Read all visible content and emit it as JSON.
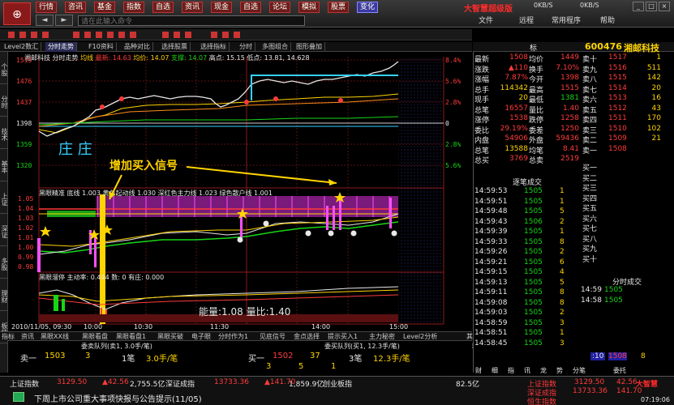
{
  "toolbar": {
    "buttons": [
      "行情",
      "咨讯",
      "基金",
      "指数",
      "自选",
      "资讯",
      "现金",
      "自选",
      "论坛",
      "模拟",
      "股票",
      "变化"
    ],
    "command_placeholder": "请在此输入命令",
    "back": "◄",
    "forward": "►"
  },
  "brand": "大智慧超级版",
  "speed": [
    "0KB/S",
    "0KB/S"
  ],
  "menus": [
    "文件",
    "远程",
    "常用程序",
    "帮助"
  ],
  "tabs": [
    "Level2数汇",
    "分时走势",
    "F10资料",
    "品种对比",
    "选择股票",
    "选择指标",
    "分时",
    "多图组合",
    "图形叠加"
  ],
  "vertical_tabs": [
    "个股",
    "分时",
    "技术",
    "基本",
    "上证",
    "深证",
    "多股",
    "理财",
    "板块"
  ],
  "chart": {
    "header_name": "湘邮科技 分时走势",
    "header_label": "均线",
    "header_values": [
      "最新: 14.63",
      "均价: 14.07",
      "支撑: 14.07",
      "高点: 15.15",
      "低点: 13.81, 14.628"
    ],
    "y_prices": [
      "1515",
      "1476",
      "1437",
      "1398",
      "1359",
      "1320"
    ],
    "y_pcts": [
      "8.4%",
      "5.6%",
      "2.8%",
      "0",
      "2.8%",
      "5.6%"
    ],
    "mid_prices": [
      "1.05",
      "1.04",
      "1.03",
      "1.02",
      "1.01",
      "1.00",
      "0.99",
      "0.98"
    ],
    "mid_header": "黑眼精准  底线 1.003   黄色起动线 1.030  深红色主力线 1.023  绿色散户线 1.001",
    "low_header": "黑眼溜停   主动率: 0.444  数: 0  有庄: 0.000",
    "annotation": "增加买入信号",
    "volume_ratio": "能量:1.08   量比:1.40",
    "zhuang": "庄 庄",
    "times": [
      "2010/11/05, 09:30",
      "10:00",
      "10:30",
      "11:30",
      "14:00",
      "15:00"
    ]
  },
  "quote": {
    "code": "600476",
    "name": "湘邮科技",
    "title_tab": "标",
    "rows": [
      {
        "l": "最新",
        "v": "1508",
        "l2": "均价",
        "v2": "1449"
      },
      {
        "l": "涨跌",
        "v": "▲110",
        "l2": "换手",
        "v2": "7.10%"
      },
      {
        "l": "涨幅",
        "v": "7.87%",
        "l2": "今开",
        "v2": "1398"
      },
      {
        "l": "总手",
        "v": "114342",
        "l2": "最高",
        "v2": "1515"
      },
      {
        "l": "现手",
        "v": "20",
        "l2": "最低",
        "v2": "1381"
      },
      {
        "l": "总笔",
        "v": "16557",
        "l2": "量比",
        "v2": "1.40"
      },
      {
        "l": "涨停",
        "v": "1538",
        "l2": "跌停",
        "v2": "1258"
      },
      {
        "l": "委比",
        "v": "29.19%",
        "l2": "委差",
        "v2": "1250"
      },
      {
        "l": "内盘",
        "v": "54906",
        "l2": "外盘",
        "v2": "59436"
      },
      {
        "l": "总笔",
        "v": "13588",
        "l2": "均笔",
        "v2": "8.41"
      },
      {
        "l": "总买",
        "v": "3769",
        "l2": "总卖",
        "v2": "2519"
      }
    ],
    "asks": [
      {
        "l": "卖十",
        "p": "1517",
        "v": "1"
      },
      {
        "l": "卖九",
        "p": "1516",
        "v": "511"
      },
      {
        "l": "卖八",
        "p": "1515",
        "v": "142"
      },
      {
        "l": "卖七",
        "p": "1514",
        "v": "20"
      },
      {
        "l": "卖六",
        "p": "1513",
        "v": "16"
      },
      {
        "l": "卖五",
        "p": "1512",
        "v": "43"
      },
      {
        "l": "卖四",
        "p": "1511",
        "v": "170"
      },
      {
        "l": "卖三",
        "p": "1510",
        "v": "102"
      },
      {
        "l": "卖二",
        "p": "1509",
        "v": "21"
      },
      {
        "l": "卖一",
        "p": "1508",
        "v": ""
      }
    ],
    "bids": [
      "买一",
      "买二",
      "买三",
      "买四",
      "买五",
      "买六",
      "买七",
      "买八",
      "买九",
      "买十"
    ],
    "trades_title": "逐笔成交",
    "trades": [
      {
        "t": "14:59:53",
        "p": "1505",
        "v": "1"
      },
      {
        "t": "14:59:51",
        "p": "1505",
        "v": "1"
      },
      {
        "t": "14:59:48",
        "p": "1505",
        "v": "5"
      },
      {
        "t": "14:59:43",
        "p": "1506",
        "v": "2"
      },
      {
        "t": "14:59:39",
        "p": "1505",
        "v": "1"
      },
      {
        "t": "14:59:33",
        "p": "1505",
        "v": "8"
      },
      {
        "t": "14:59:26",
        "p": "1505",
        "v": "2"
      },
      {
        "t": "14:59:21",
        "p": "1505",
        "v": "6"
      },
      {
        "t": "14:59:15",
        "p": "1505",
        "v": "4"
      },
      {
        "t": "14:59:13",
        "p": "1505",
        "v": "5"
      },
      {
        "t": "14:59:11",
        "p": "1505",
        "v": "8"
      },
      {
        "t": "14:59:08",
        "p": "1505",
        "v": "8"
      },
      {
        "t": "14:59:03",
        "p": "1505",
        "v": "2"
      },
      {
        "t": "14:58:59",
        "p": "1505",
        "v": "3"
      },
      {
        "t": "14:58:51",
        "p": "1505",
        "v": "1"
      },
      {
        "t": "14:58:45",
        "p": "1505",
        "v": "3"
      }
    ],
    "fen_title": "分时成交",
    "fen": [
      {
        "t": "14:59",
        "p": "1505",
        "v": ""
      },
      {
        "t": "14:58",
        "p": "1505",
        "v": ""
      }
    ],
    "last_row": {
      "t": ":10",
      "p": "1508",
      "v": "8"
    },
    "bottom_tabs": [
      "财",
      "细",
      "指",
      "讯",
      "龙",
      "势",
      "分笔",
      "委托"
    ]
  },
  "bottom_tabs": [
    "指标",
    "资讯",
    "黑眼XX线",
    "黑眼看盘",
    "黑眼看盘1",
    "黑眼买破",
    "电子眼",
    "分时作为1",
    "见底信号",
    "金点选择",
    "提示买入1",
    "主力秘密",
    "Level2分析",
    "其他"
  ],
  "queue": {
    "left_title": "委卖队列(卖1, 3.0手/笔)",
    "right_title": "委买队列(买1, 12.3手/笔)",
    "left": {
      "label": "卖一",
      "price": "1503",
      "n": "3",
      "bi": "1笔",
      "per": "3.0手/笔"
    },
    "right": {
      "label": "买一",
      "price": "1502",
      "n": "37",
      "bi": "3笔",
      "per": "12.3手/笔"
    },
    "right2": [
      "3",
      "5",
      "1"
    ]
  },
  "status": {
    "sh": {
      "name": "上证指数",
      "val": "3129.50",
      "chg": "▲42.56",
      "amt": "2,755.5亿"
    },
    "sz": {
      "name": "深证成指",
      "val": "13733.36",
      "chg": "▲141.70",
      "amt": "1,859.9亿"
    },
    "cy": {
      "name": "创业板指",
      "val": "",
      "chg": "",
      "amt": "82.5亿"
    },
    "news": "下周上市公司重大事项快报与公告提示(11/05)",
    "right_idx": [
      {
        "name": "上证指数",
        "val": "3129.50",
        "chg": "42.56"
      },
      {
        "name": "深证成指",
        "val": "13733.36",
        "chg": "141.70"
      },
      {
        "name": "恒生指数",
        "val": "",
        "chg": ""
      }
    ],
    "clock": "07:19:06",
    "right_brand": "大智慧"
  },
  "colors": {
    "up": "#ff3b3b",
    "down": "#17d617",
    "avg": "#ffd400",
    "price": "#ffffff"
  }
}
